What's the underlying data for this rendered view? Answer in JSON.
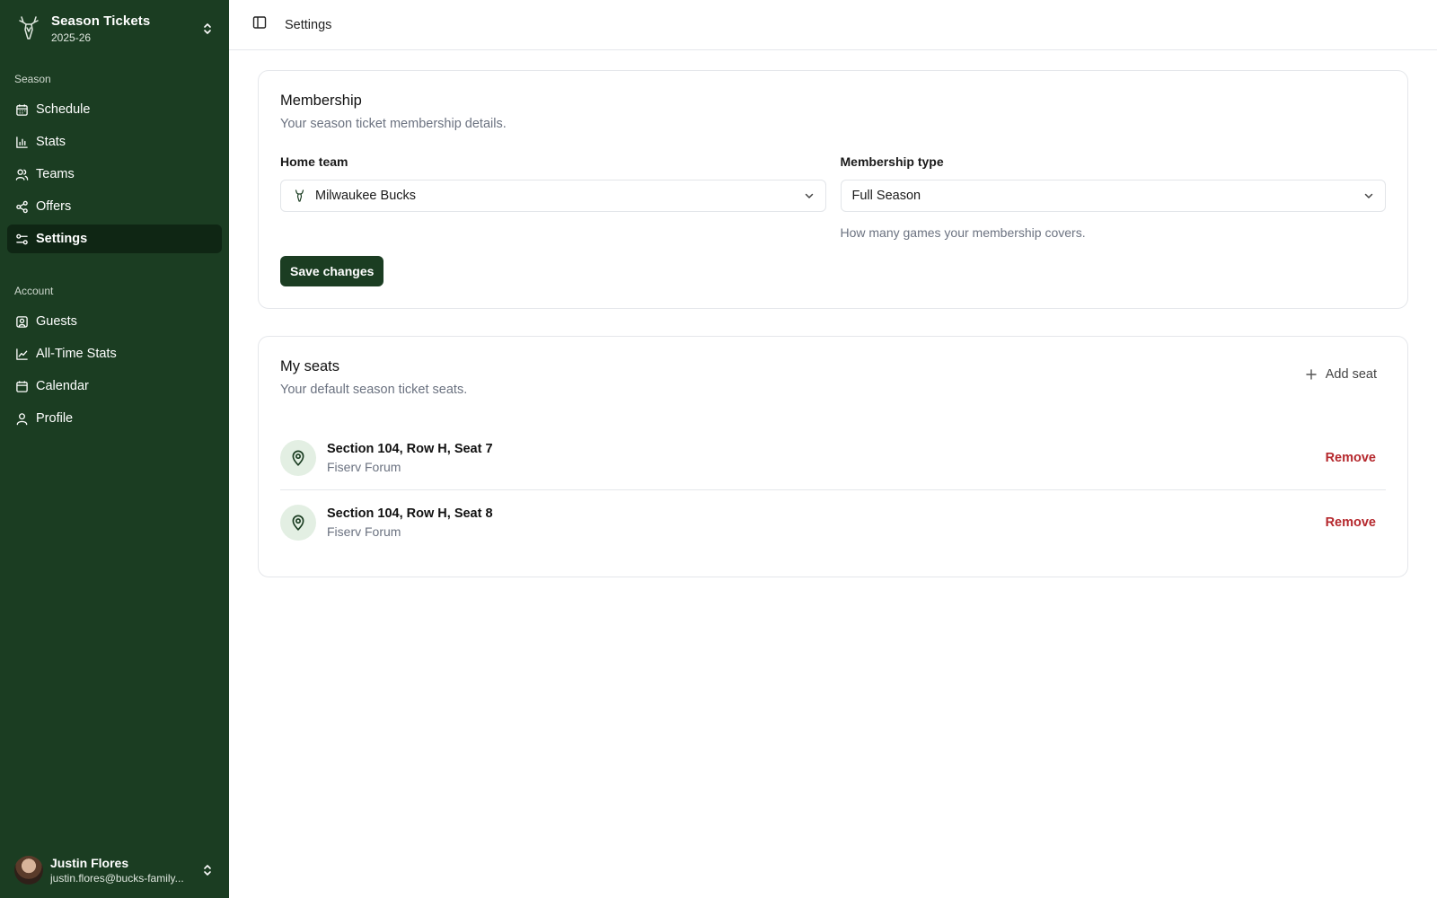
{
  "sidebar": {
    "brand": {
      "title": "Season Tickets",
      "subtitle": "2025-26",
      "logo_icon": "bucks-deer-logo"
    },
    "sections": [
      {
        "label": "Season"
      },
      {
        "label": "Account"
      }
    ],
    "season_items": [
      {
        "label": "Schedule",
        "icon": "calendar-grid-icon"
      },
      {
        "label": "Stats",
        "icon": "bar-chart-icon"
      },
      {
        "label": "Teams",
        "icon": "users-icon"
      },
      {
        "label": "Offers",
        "icon": "share-icon"
      },
      {
        "label": "Settings",
        "icon": "sliders-icon",
        "active": true
      }
    ],
    "account_items": [
      {
        "label": "Guests",
        "icon": "contact-icon"
      },
      {
        "label": "All-Time Stats",
        "icon": "line-chart-icon"
      },
      {
        "label": "Calendar",
        "icon": "calendar-icon"
      },
      {
        "label": "Profile",
        "icon": "user-icon"
      }
    ],
    "user": {
      "name": "Justin Flores",
      "email": "justin.flores@bucks-family..."
    }
  },
  "topbar": {
    "breadcrumb": "Settings"
  },
  "membership": {
    "title": "Membership",
    "description": "Your season ticket membership details.",
    "home_team": {
      "label": "Home team",
      "value": "Milwaukee Bucks"
    },
    "membership_type": {
      "label": "Membership type",
      "value": "Full Season",
      "help": "How many games your membership covers."
    },
    "save_label": "Save changes"
  },
  "seats": {
    "title": "My seats",
    "description": "Your default season ticket seats.",
    "add_label": "Add seat",
    "items": [
      {
        "title": "Section 104, Row H, Seat 7",
        "venue": "Fiserv Forum",
        "action": "Remove"
      },
      {
        "title": "Section 104, Row H, Seat 8",
        "venue": "Fiserv Forum",
        "action": "Remove"
      }
    ]
  },
  "colors": {
    "sidebar_bg": "#1b3d22",
    "active_item_bg": "#0f2614",
    "primary_button": "#1b3d22",
    "danger": "#b5282d",
    "seat_icon_bg": "#e3efe3"
  }
}
